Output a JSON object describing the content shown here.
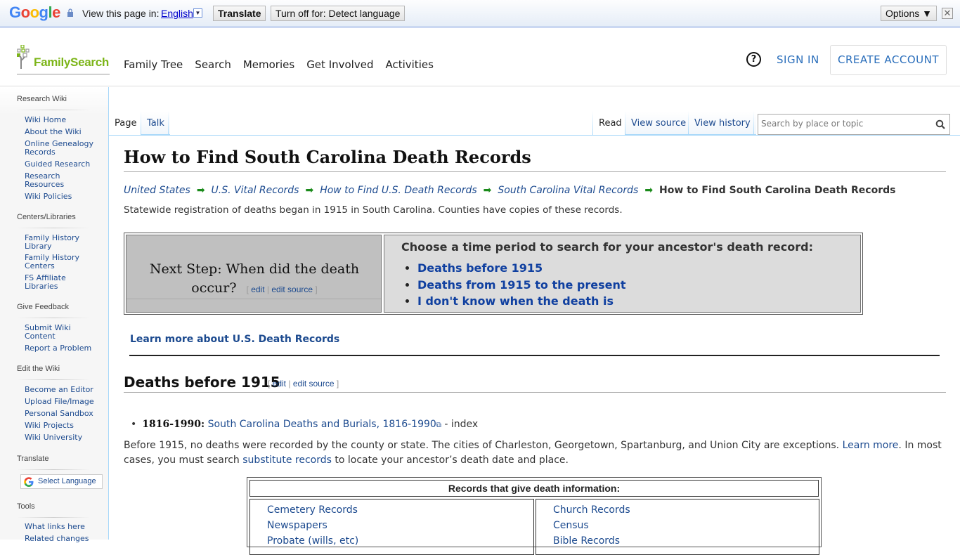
{
  "translate_bar": {
    "brand": "Google",
    "view_label": "View this page in:",
    "language": "English",
    "translate_button": "Translate",
    "turn_off_button": "Turn off for: Detect language",
    "options_button": "Options ▼",
    "close": "✕"
  },
  "header": {
    "logo_text": "FamilySearch",
    "nav": [
      "Family Tree",
      "Search",
      "Memories",
      "Get Involved",
      "Activities"
    ],
    "help": "?",
    "sign_in": "SIGN IN",
    "create_account": "CREATE ACCOUNT"
  },
  "sidebar": {
    "sections": [
      {
        "title": "Research Wiki",
        "items": [
          "Wiki Home",
          "About the Wiki",
          "Online Genealogy Records",
          "Guided Research",
          "Research Resources",
          "Wiki Policies"
        ]
      },
      {
        "title": "Centers/Libraries",
        "items": [
          "Family History Library",
          "Family History Centers",
          "FS Affiliate Libraries"
        ]
      },
      {
        "title": "Give Feedback",
        "items": [
          "Submit Wiki Content",
          "Report a Problem"
        ]
      },
      {
        "title": "Edit the Wiki",
        "items": [
          "Become an Editor",
          "Upload File/Image",
          "Personal Sandbox",
          "Wiki Projects",
          "Wiki University"
        ]
      },
      {
        "title": "Translate",
        "select_language": "Select Language"
      },
      {
        "title": "Tools",
        "items": [
          "What links here",
          "Related changes"
        ]
      }
    ]
  },
  "tabs": {
    "page": "Page",
    "talk": "Talk",
    "read": "Read",
    "view_source": "View source",
    "view_history": "View history",
    "search_placeholder": "Search by place or topic"
  },
  "article": {
    "title": "How to Find South Carolina Death Records",
    "breadcrumb": [
      "United States",
      "U.S. Vital Records",
      "How to Find U.S. Death Records",
      "South Carolina Vital Records"
    ],
    "breadcrumb_current": "How to Find South Carolina Death Records",
    "intro": "Statewide registration of deaths began in 1915 in South Carolina. Counties have copies of these records.",
    "next_step": {
      "question": "Next Step: When did the death occur?",
      "edit": "edit",
      "edit_source": "edit source",
      "choose_heading": "Choose a time period to search for your ancestor's death record:",
      "options": [
        "Deaths before 1915",
        "Deaths from 1915 to the present",
        "I don't know when the death is"
      ]
    },
    "learn_more_link": "Learn more about U.S. Death Records",
    "section_heading": "Deaths before 1915",
    "bullet_years": "1816-1990:",
    "bullet_link": "South Carolina Deaths and Burials, 1816-1990",
    "bullet_suffix": "- index",
    "para_part1": "Before 1915, no deaths were recorded by the county or state. The cities of Charleston, Georgetown, Spartanburg, and Union City are exceptions.",
    "para_learn_more": "Learn more",
    "para_part2": ". In most cases, you must search",
    "para_substitute": "substitute records",
    "para_part3": "to locate your ancestor’s death date and place.",
    "records_table": {
      "heading": "Records that give death information:",
      "left": [
        "Cemetery Records",
        "Newspapers",
        "Probate (wills, etc)"
      ],
      "right": [
        "Church Records",
        "Census",
        "Bible Records"
      ]
    }
  }
}
